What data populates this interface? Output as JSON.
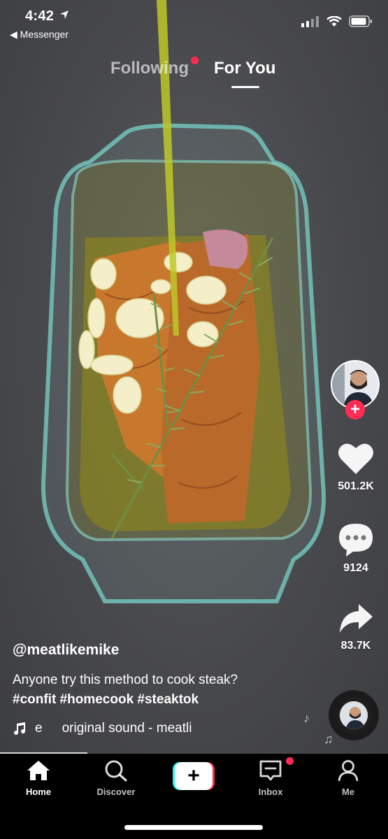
{
  "status_bar": {
    "time": "4:42",
    "back_app": "Messenger"
  },
  "top_tabs": {
    "following": "Following",
    "for_you": "For You"
  },
  "actions": {
    "likes": "501.2K",
    "comments": "9124",
    "shares": "83.7K"
  },
  "caption": {
    "username": "@meatlikemike",
    "description": "Anyone try this method to cook steak?",
    "hashtags": "#confit #homecook #steaktok"
  },
  "sound": {
    "prefix": "e",
    "title": "original sound - meatli"
  },
  "bottom_nav": {
    "home": "Home",
    "discover": "Discover",
    "inbox": "Inbox",
    "me": "Me"
  },
  "colors": {
    "accent": "#fe2c55",
    "cyan": "#25f4ee",
    "nav_bg": "#000000"
  }
}
